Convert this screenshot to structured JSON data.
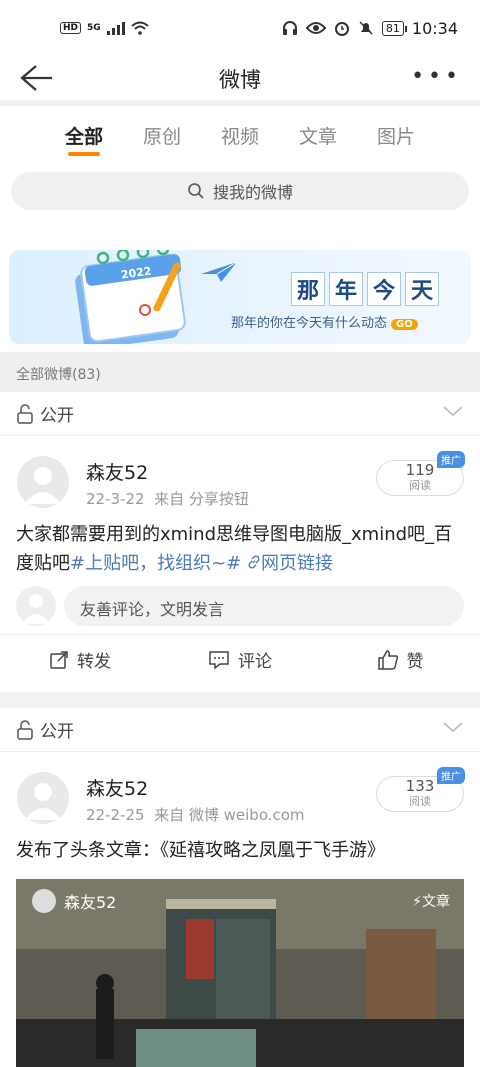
{
  "status": {
    "time": "10:34",
    "battery": "81",
    "hd": "HD",
    "net": "5G"
  },
  "nav": {
    "title": "微博"
  },
  "tabs": [
    "全部",
    "原创",
    "视频",
    "文章",
    "图片"
  ],
  "search": {
    "placeholder": "搜我的微博"
  },
  "banner": {
    "title_chars": [
      "那",
      "年",
      "今",
      "天"
    ],
    "subtitle": "那年的你在今天有什么动态",
    "go": "GO",
    "year": "2022"
  },
  "count_label": "全部微博(83)",
  "posts": [
    {
      "visibility": "公开",
      "user": "森友52",
      "date": "22-3-22",
      "source": "来自 分享按钮",
      "reads": "119",
      "reads_label": "阅读",
      "badge": "推广",
      "text": "大家都需要用到的xmind思维导图电脑版_xmind吧_百度贴吧",
      "hashtag": "#上贴吧，找组织~#",
      "link": "网页链接",
      "comment_placeholder": "友善评论，文明发言",
      "actions": [
        "转发",
        "评论",
        "赞"
      ]
    },
    {
      "visibility": "公开",
      "user": "森友52",
      "date": "22-2-25",
      "source": "来自 微博 weibo.com",
      "reads": "133",
      "reads_label": "阅读",
      "badge": "推广",
      "text": "发布了头条文章：《延禧攻略之凤凰于飞手游》",
      "media_user": "森友52",
      "media_badge": "文章"
    }
  ]
}
